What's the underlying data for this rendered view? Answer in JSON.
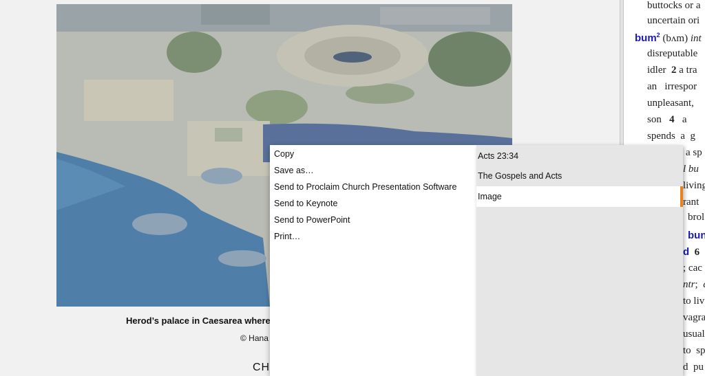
{
  "document": {
    "caption": "Herod’s palace in Caesarea where",
    "credit": "© Hana",
    "chapter": "CHA"
  },
  "dictionary": {
    "lines": [
      "buttocks or a",
      "uncertain ori",
      "(bʌm)",
      "int",
      "disreputable",
      "idler",
      "2",
      "a tra",
      "an",
      "irrespor",
      "unpleasant,",
      "son",
      "4",
      "a",
      "spends",
      "a",
      "g",
      "a sp",
      "l",
      "bu",
      "living",
      "rant",
      "brol",
      "bun",
      "d",
      "6",
      ";",
      "cac",
      "ntr",
      ";",
      "c",
      "to liv",
      "vagra",
      "usual",
      "to",
      "sp",
      "d",
      "pu"
    ],
    "headword": "bum",
    "sup": "2"
  },
  "context_menu": {
    "items": [
      "Copy",
      "Save as…",
      "Send to Proclaim Church Presentation Software",
      "Send to Keynote",
      "Send to PowerPoint",
      "Print…"
    ]
  },
  "submenu": {
    "items": [
      "Acts 23:34",
      "The Gospels and Acts",
      "Image"
    ],
    "accent_color": "#e8821a"
  }
}
